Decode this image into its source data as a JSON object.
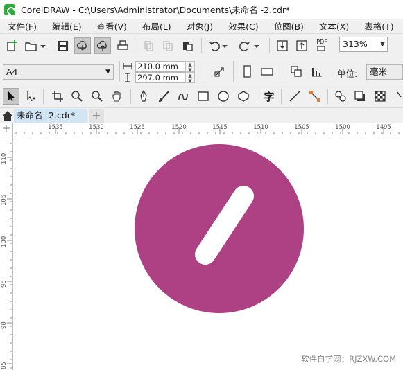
{
  "window": {
    "title": "CorelDRAW - C:\\Users\\Administrator\\Documents\\未命名 -2.cdr*"
  },
  "menu": {
    "items": [
      "文件(F)",
      "编辑(E)",
      "查看(V)",
      "布局(L)",
      "对象(J)",
      "效果(C)",
      "位图(B)",
      "文本(X)",
      "表格(T)"
    ]
  },
  "standard_toolbar": {
    "zoom_value": "313%",
    "icons": [
      "new-document-icon",
      "open-icon",
      "save-icon",
      "cloud-download-icon",
      "cloud-upload-icon",
      "print-icon",
      "cut-icon",
      "copy-icon",
      "paste-icon",
      "undo-icon",
      "redo-icon",
      "import-icon",
      "export-icon",
      "export-pdf-icon"
    ],
    "pdf_label": "PDF"
  },
  "property_bar": {
    "page_size": "A4",
    "width": "210.0 mm",
    "height": "297.0 mm",
    "unit_label": "单位:",
    "unit_value": "毫米"
  },
  "toolbox": {
    "icons": [
      "pick-tool-icon",
      "shape-tool-icon",
      "crop-tool-icon",
      "zoom-tool-icon",
      "zoom-out-icon",
      "pan-tool-icon",
      "pen-tool-icon",
      "brush-tool-icon",
      "freehand-tool-icon",
      "rectangle-tool-icon",
      "ellipse-tool-icon",
      "polygon-tool-icon",
      "text-tool-icon",
      "line-tool-icon",
      "connector-tool-icon",
      "blend-tool-icon",
      "shadow-tool-icon",
      "transparency-tool-icon"
    ],
    "text_tool_glyph": "字"
  },
  "tabs": {
    "document_tab": "未命名 -2.cdr*",
    "add_tab": "+"
  },
  "ruler": {
    "horizontal_labels": [
      "1535",
      "1530",
      "1525",
      "1520",
      "1515",
      "1510",
      "1505",
      "1500",
      "1495"
    ],
    "vertical_labels": [
      "110",
      "105",
      "100",
      "95",
      "90",
      "85"
    ]
  },
  "artwork": {
    "circle_color": "#ae4084",
    "bar_color": "#ffffff"
  },
  "watermark": "软件自学网：RJZXW.COM"
}
